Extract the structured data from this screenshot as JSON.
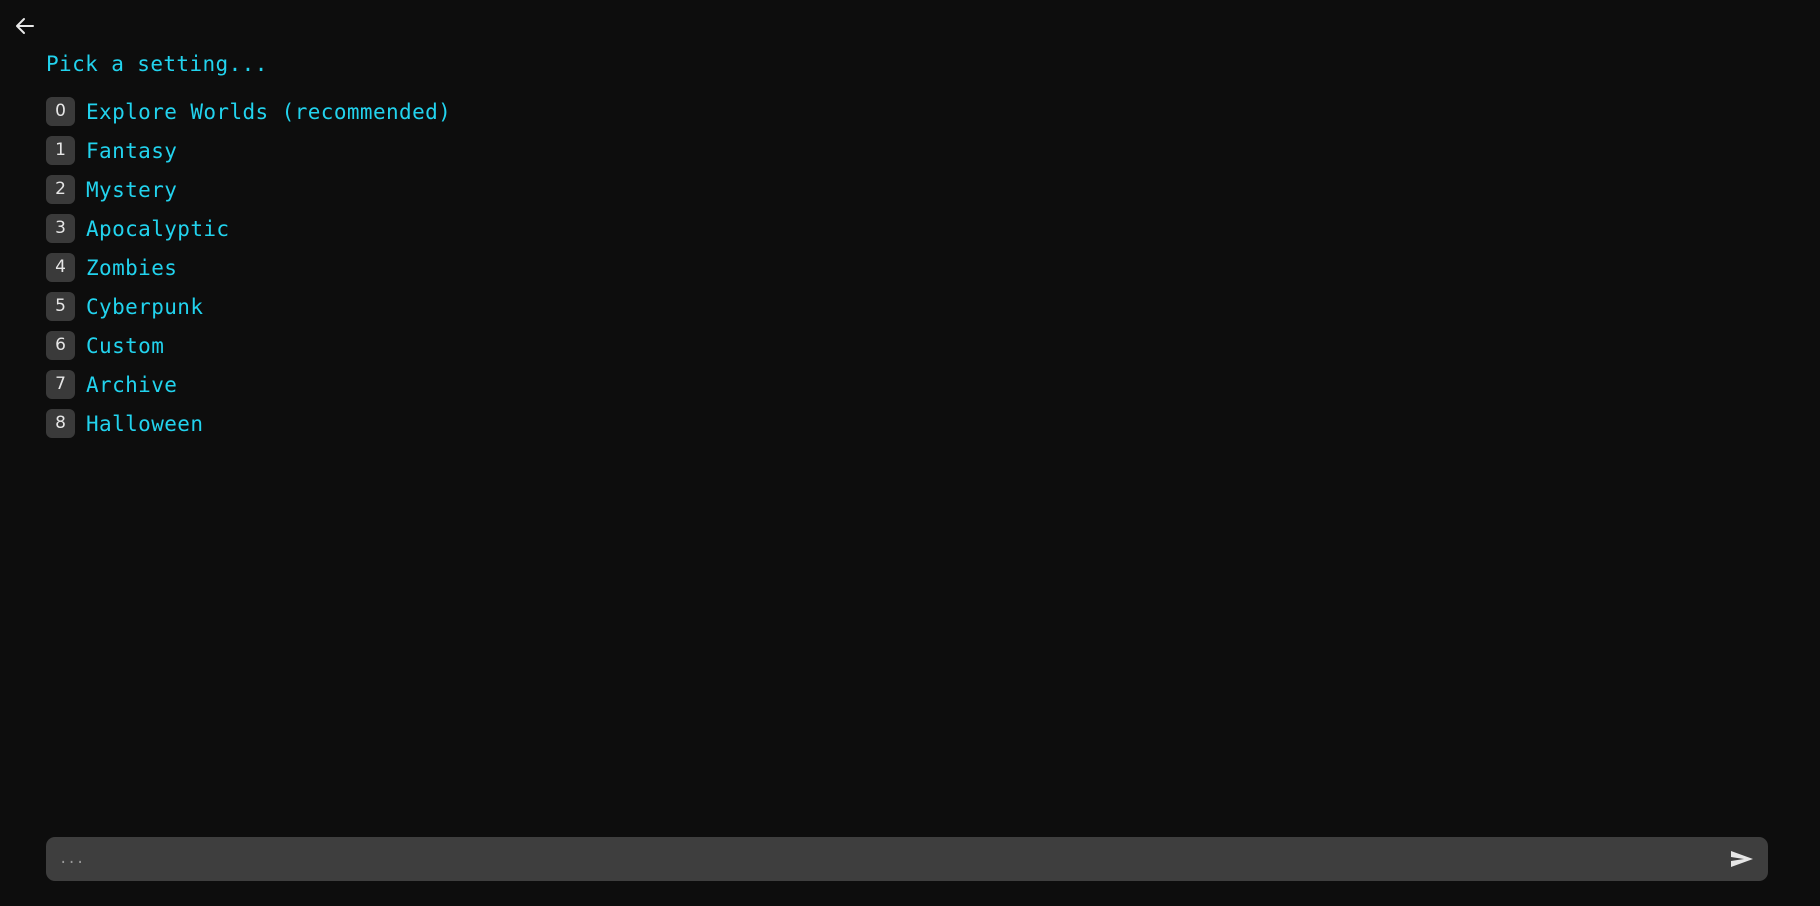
{
  "app": {
    "background_color": "#0d0d0d",
    "accent_color": "#22d3ee",
    "badge_color": "#3a3a3a",
    "composer_color": "#3e3e3e"
  },
  "header": {
    "back_label": "Back",
    "back_icon": "arrow-left-icon"
  },
  "main": {
    "prompt_title": "Pick a setting...",
    "options": [
      {
        "index": "0",
        "label": "Explore Worlds (recommended)"
      },
      {
        "index": "1",
        "label": "Fantasy"
      },
      {
        "index": "2",
        "label": "Mystery"
      },
      {
        "index": "3",
        "label": "Apocalyptic"
      },
      {
        "index": "4",
        "label": "Zombies"
      },
      {
        "index": "5",
        "label": "Cyberpunk"
      },
      {
        "index": "6",
        "label": "Custom"
      },
      {
        "index": "7",
        "label": "Archive"
      },
      {
        "index": "8",
        "label": "Halloween"
      }
    ]
  },
  "composer": {
    "placeholder": "...",
    "value": "",
    "send_label": "Send",
    "send_icon": "send-icon"
  }
}
